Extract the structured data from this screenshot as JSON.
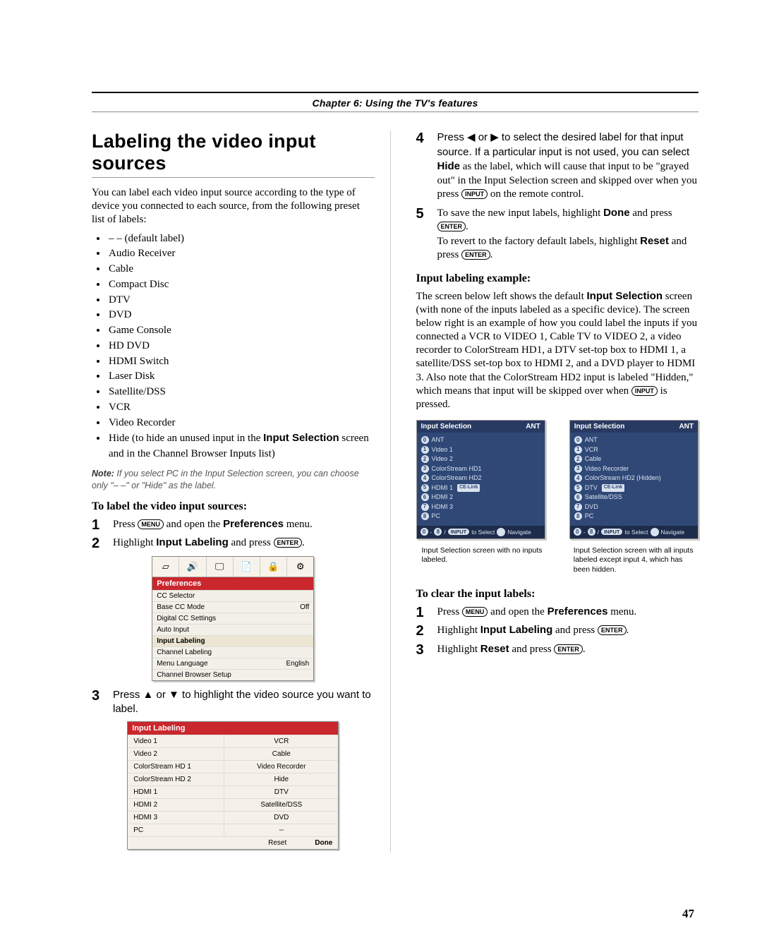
{
  "chapter_header": "Chapter 6: Using the TV's features",
  "title": "Labeling the video input sources",
  "intro": "You can label each video input source according to the type of device you connected to each source, from the following preset list of labels:",
  "labels": [
    "– – (default label)",
    "Audio Receiver",
    "Cable",
    "Compact Disc",
    "DTV",
    "DVD",
    "Game Console",
    "HD DVD",
    "HDMI Switch",
    "Laser Disk",
    "Satellite/DSS",
    "VCR",
    "Video Recorder"
  ],
  "hide_bullet_prefix": "Hide (to hide an unused input in the ",
  "hide_bullet_bold": "Input Selection",
  "hide_bullet_suffix": " screen and in the Channel Browser Inputs list)",
  "note_label": "Note:",
  "note_text": " If you select PC in the Input Selection screen, you can choose only \"– –\" or \"Hide\"  as the label.",
  "to_label_head": "To label the video input sources:",
  "steps_left": {
    "s1_a": "Press ",
    "s1_key": "MENU",
    "s1_b": " and open the ",
    "s1_bold": "Preferences",
    "s1_c": " menu.",
    "s2_a": "Highlight ",
    "s2_bold": "Input Labeling",
    "s2_b": " and press ",
    "s2_key": "ENTER",
    "s2_c": ".",
    "s3": "Press ▲ or ▼ to highlight the video source you want to label."
  },
  "prefs_title": "Preferences",
  "prefs_rows": [
    {
      "l": "CC Selector",
      "r": ""
    },
    {
      "l": "Base CC Mode",
      "r": "Off"
    },
    {
      "l": "Digital CC Settings",
      "r": ""
    },
    {
      "l": "Auto Input",
      "r": ""
    },
    {
      "l": "Input Labeling",
      "r": "",
      "hl": true
    },
    {
      "l": "Channel Labeling",
      "r": ""
    },
    {
      "l": "Menu Language",
      "r": "English"
    },
    {
      "l": "Channel Browser Setup",
      "r": ""
    }
  ],
  "il_title": "Input Labeling",
  "il_rows": [
    {
      "l": "Video 1",
      "r": "VCR"
    },
    {
      "l": "Video 2",
      "r": "Cable"
    },
    {
      "l": "ColorStream HD 1",
      "r": "Video Recorder"
    },
    {
      "l": "ColorStream HD 2",
      "r": "Hide"
    },
    {
      "l": "HDMI 1",
      "r": "DTV"
    },
    {
      "l": "HDMI 2",
      "r": "Satellite/DSS"
    },
    {
      "l": "HDMI 3",
      "r": "DVD"
    },
    {
      "l": "PC",
      "r": "--"
    }
  ],
  "il_reset": "Reset",
  "il_done": "Done",
  "right": {
    "s4_a": "Press ◀ or ▶ to select the desired label for that input source. If a particular input is not used, you can select ",
    "s4_bold": "Hide",
    "s4_b": " as the label, which will cause that input to be \"grayed out\" in the Input Selection screen and skipped over when you press ",
    "s4_key": "INPUT",
    "s4_c": " on the remote control.",
    "s5_a": "To save the new input labels, highlight ",
    "s5_bold": "Done",
    "s5_b": " and press ",
    "s5_key": "ENTER",
    "s5_c": ".",
    "s5_revert_a": "To revert to the factory default labels, highlight ",
    "s5_revert_bold": "Reset",
    "s5_revert_b": " and press ",
    "s5_revert_key": "ENTER",
    "s5_revert_c": "."
  },
  "example_head": "Input labeling example:",
  "example_p1_a": "The screen below left shows the default ",
  "example_p1_bold": "Input Selection",
  "example_p1_b": " screen (with none of the inputs labeled as a specific device). The screen below right is an example of how you could label the inputs if you connected a VCR to VIDEO 1, Cable TV to VIDEO 2, a video recorder to ColorStream HD1, a DTV set-top box to HDMI 1, a satellite/DSS set-top box to HDMI 2, and a DVD player to HDMI 3. Also note that the ColorStream HD2 input is labeled \"Hidden,\" which means that input will be skipped over when ",
  "example_p1_key": "INPUT",
  "example_p1_c": " is pressed.",
  "sel_title": "Input Selection",
  "sel_ant": "ANT",
  "sel_left": [
    "ANT",
    "Video 1",
    "Video 2",
    "ColorStream HD1",
    "ColorStream HD2",
    "HDMI 1",
    "HDMI 2",
    "HDMI 3",
    "PC"
  ],
  "sel_left_badge_index": 5,
  "sel_left_badge": "CE-Link",
  "sel_right": [
    "ANT",
    "VCR",
    "Cable",
    "Video Recorder",
    "ColorStream HD2 (Hidden)",
    "DTV",
    "Satellite/DSS",
    "DVD",
    "PC"
  ],
  "sel_right_badge_index": 5,
  "sel_right_badge": "CE-Link",
  "sel_foot_numA": "0",
  "sel_foot_dash": "-",
  "sel_foot_numB": "8",
  "sel_foot_slash": "/",
  "sel_foot_input": "INPUT",
  "sel_foot_select": "to Select",
  "sel_foot_nav": "Navigate",
  "cap_left": "Input Selection screen with no inputs labeled.",
  "cap_right": "Input Selection screen with all inputs labeled except input 4, which has been hidden.",
  "clear_head": "To clear the input labels:",
  "clear_steps": {
    "s1_a": "Press ",
    "s1_key": "MENU",
    "s1_b": " and open the ",
    "s1_bold": "Preferences",
    "s1_c": " menu.",
    "s2_a": "Highlight ",
    "s2_bold": "Input Labeling",
    "s2_b": " and press ",
    "s2_key": "ENTER",
    "s2_c": ".",
    "s3_a": "Highlight ",
    "s3_bold": "Reset",
    "s3_b": " and press ",
    "s3_key": "ENTER",
    "s3_c": "."
  },
  "page_number": "47"
}
